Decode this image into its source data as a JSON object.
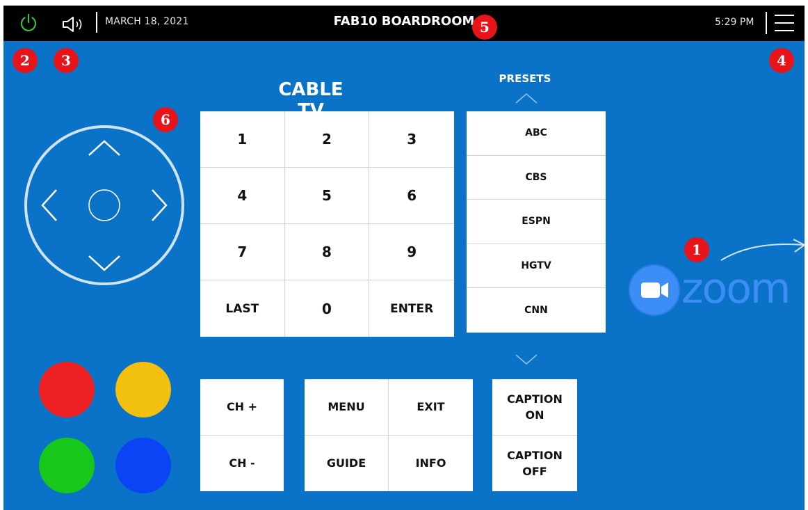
{
  "topbar": {
    "date": "MARCH 18, 2021",
    "room": "FAB10 BOARDROOM",
    "time": "5:29 PM"
  },
  "badges": [
    "1",
    "2",
    "3",
    "4",
    "5",
    "6"
  ],
  "cable": {
    "title": "CABLE TV",
    "keys": [
      "1",
      "2",
      "3",
      "4",
      "5",
      "6",
      "7",
      "8",
      "9",
      "LAST",
      "0",
      "ENTER"
    ]
  },
  "presets": {
    "title": "PRESETS",
    "items": [
      "ABC",
      "CBS",
      "ESPN",
      "HGTV",
      "CNN"
    ]
  },
  "controls": {
    "ch_up": "CH +",
    "ch_down": "CH -",
    "menu": "MENU",
    "exit": "EXIT",
    "guide": "GUIDE",
    "info": "INFO",
    "caption_on": "CAPTION ON",
    "caption_off": "CAPTION OFF"
  },
  "color_buttons": [
    "#ee2222",
    "#f2c10f",
    "#18c71b",
    "#0b44f5"
  ],
  "zoom": {
    "logo_text": "zoom"
  },
  "colors": {
    "background": "#0a73c8",
    "topbar": "#000000",
    "power": "#3fbf3f",
    "badge": "#e7141a"
  }
}
